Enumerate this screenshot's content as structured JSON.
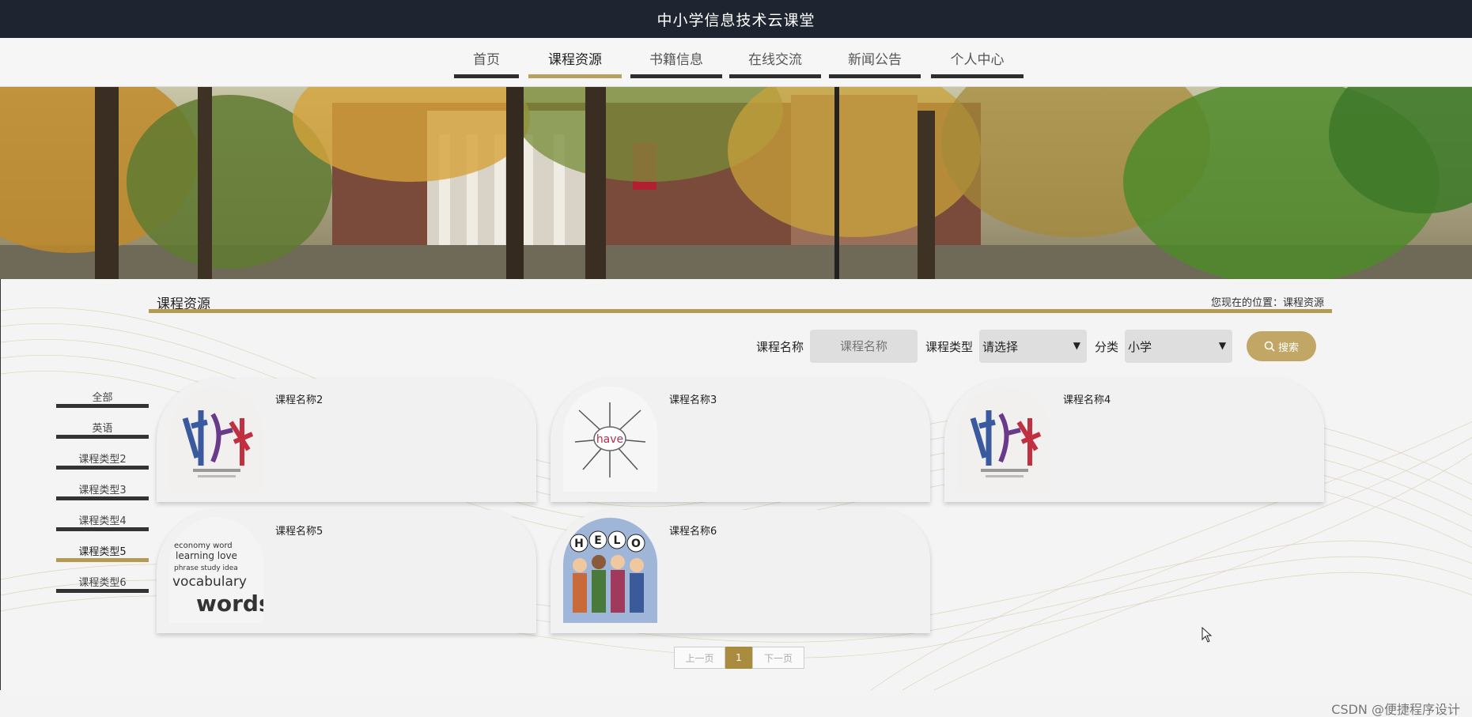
{
  "app": {
    "title": "中小学信息技术云课堂"
  },
  "nav": {
    "items": [
      {
        "label": "首页",
        "active": false
      },
      {
        "label": "课程资源",
        "active": true
      },
      {
        "label": "书籍信息",
        "active": false
      },
      {
        "label": "在线交流",
        "active": false
      },
      {
        "label": "新闻公告",
        "active": false
      },
      {
        "label": "个人中心",
        "active": false
      }
    ]
  },
  "section": {
    "title": "课程资源",
    "breadcrumb": "您现在的位置：课程资源"
  },
  "search": {
    "name_label": "课程名称",
    "name_placeholder": "课程名称",
    "type_label": "课程类型",
    "type_value": "请选择",
    "category_label": "分类",
    "category_value": "小学",
    "button_label": "搜索"
  },
  "categories": [
    {
      "label": "全部",
      "active": false
    },
    {
      "label": "英语",
      "active": false
    },
    {
      "label": "课程类型2",
      "active": false
    },
    {
      "label": "课程类型3",
      "active": false
    },
    {
      "label": "课程类型4",
      "active": false
    },
    {
      "label": "课程类型5",
      "active": true
    },
    {
      "label": "课程类型6",
      "active": false
    }
  ],
  "courses": [
    {
      "title": "课程名称2",
      "image": "calligraphy-image"
    },
    {
      "title": "课程名称3",
      "image": "have-wordmap-image"
    },
    {
      "title": "课程名称4",
      "image": "calligraphy-image"
    },
    {
      "title": "课程名称5",
      "image": "vocabulary-words-image"
    },
    {
      "title": "课程名称6",
      "image": "hello-kids-image"
    }
  ],
  "pagination": {
    "prev": "上一页",
    "current": "1",
    "next": "下一页"
  },
  "watermark": "CSDN @便捷程序设计",
  "colors": {
    "accent": "#b39a55",
    "topbar": "#1f2530"
  }
}
